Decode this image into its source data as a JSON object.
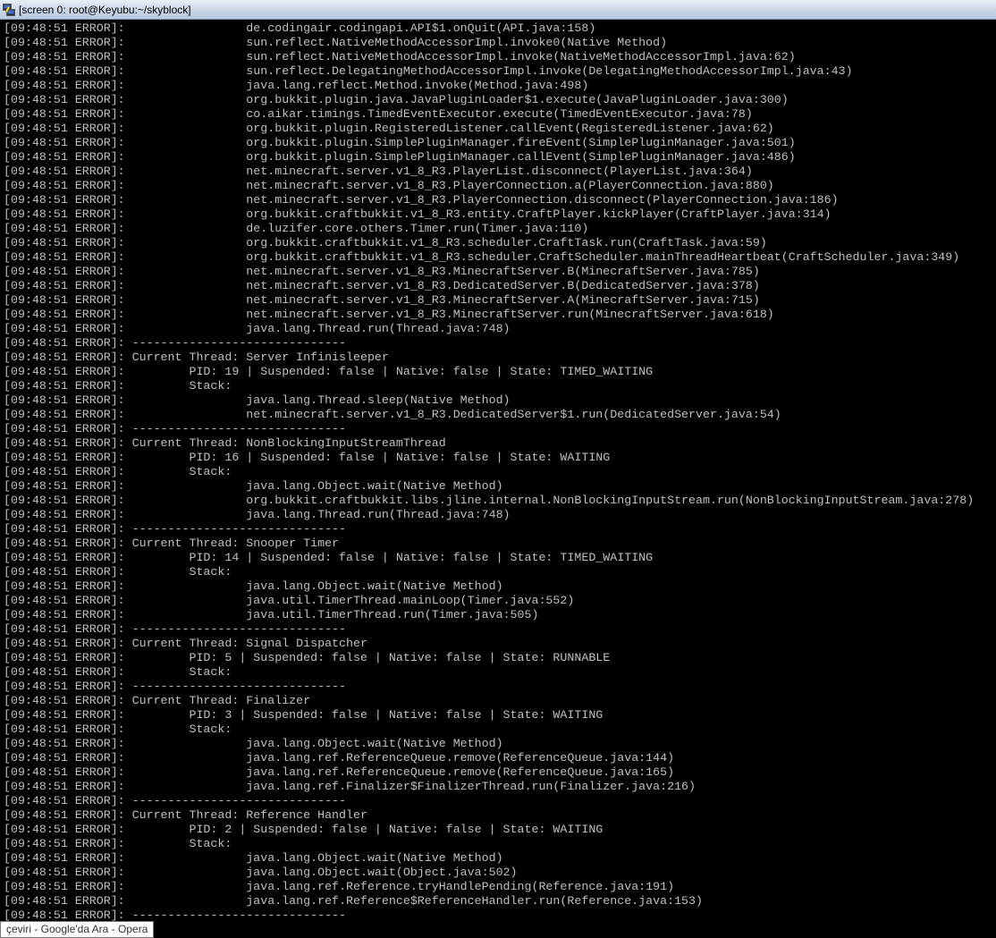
{
  "window": {
    "title": "[screen 0: root@Keyubu:~/skyblock]"
  },
  "terminal": {
    "lines": [
      "[09:48:51 ERROR]:                 de.codingair.codingapi.API$1.onQuit(API.java:158)",
      "[09:48:51 ERROR]:                 sun.reflect.NativeMethodAccessorImpl.invoke0(Native Method)",
      "[09:48:51 ERROR]:                 sun.reflect.NativeMethodAccessorImpl.invoke(NativeMethodAccessorImpl.java:62)",
      "[09:48:51 ERROR]:                 sun.reflect.DelegatingMethodAccessorImpl.invoke(DelegatingMethodAccessorImpl.java:43)",
      "[09:48:51 ERROR]:                 java.lang.reflect.Method.invoke(Method.java:498)",
      "[09:48:51 ERROR]:                 org.bukkit.plugin.java.JavaPluginLoader$1.execute(JavaPluginLoader.java:300)",
      "[09:48:51 ERROR]:                 co.aikar.timings.TimedEventExecutor.execute(TimedEventExecutor.java:78)",
      "[09:48:51 ERROR]:                 org.bukkit.plugin.RegisteredListener.callEvent(RegisteredListener.java:62)",
      "[09:48:51 ERROR]:                 org.bukkit.plugin.SimplePluginManager.fireEvent(SimplePluginManager.java:501)",
      "[09:48:51 ERROR]:                 org.bukkit.plugin.SimplePluginManager.callEvent(SimplePluginManager.java:486)",
      "[09:48:51 ERROR]:                 net.minecraft.server.v1_8_R3.PlayerList.disconnect(PlayerList.java:364)",
      "[09:48:51 ERROR]:                 net.minecraft.server.v1_8_R3.PlayerConnection.a(PlayerConnection.java:880)",
      "[09:48:51 ERROR]:                 net.minecraft.server.v1_8_R3.PlayerConnection.disconnect(PlayerConnection.java:186)",
      "[09:48:51 ERROR]:                 org.bukkit.craftbukkit.v1_8_R3.entity.CraftPlayer.kickPlayer(CraftPlayer.java:314)",
      "[09:48:51 ERROR]:                 de.luzifer.core.others.Timer.run(Timer.java:110)",
      "[09:48:51 ERROR]:                 org.bukkit.craftbukkit.v1_8_R3.scheduler.CraftTask.run(CraftTask.java:59)",
      "[09:48:51 ERROR]:                 org.bukkit.craftbukkit.v1_8_R3.scheduler.CraftScheduler.mainThreadHeartbeat(CraftScheduler.java:349)",
      "[09:48:51 ERROR]:                 net.minecraft.server.v1_8_R3.MinecraftServer.B(MinecraftServer.java:785)",
      "[09:48:51 ERROR]:                 net.minecraft.server.v1_8_R3.DedicatedServer.B(DedicatedServer.java:378)",
      "[09:48:51 ERROR]:                 net.minecraft.server.v1_8_R3.MinecraftServer.A(MinecraftServer.java:715)",
      "[09:48:51 ERROR]:                 net.minecraft.server.v1_8_R3.MinecraftServer.run(MinecraftServer.java:618)",
      "[09:48:51 ERROR]:                 java.lang.Thread.run(Thread.java:748)",
      "[09:48:51 ERROR]: ------------------------------",
      "[09:48:51 ERROR]: Current Thread: Server Infinisleeper",
      "[09:48:51 ERROR]:         PID: 19 | Suspended: false | Native: false | State: TIMED_WAITING",
      "[09:48:51 ERROR]:         Stack:",
      "[09:48:51 ERROR]:                 java.lang.Thread.sleep(Native Method)",
      "[09:48:51 ERROR]:                 net.minecraft.server.v1_8_R3.DedicatedServer$1.run(DedicatedServer.java:54)",
      "[09:48:51 ERROR]: ------------------------------",
      "[09:48:51 ERROR]: Current Thread: NonBlockingInputStreamThread",
      "[09:48:51 ERROR]:         PID: 16 | Suspended: false | Native: false | State: WAITING",
      "[09:48:51 ERROR]:         Stack:",
      "[09:48:51 ERROR]:                 java.lang.Object.wait(Native Method)",
      "[09:48:51 ERROR]:                 org.bukkit.craftbukkit.libs.jline.internal.NonBlockingInputStream.run(NonBlockingInputStream.java:278)",
      "[09:48:51 ERROR]:                 java.lang.Thread.run(Thread.java:748)",
      "[09:48:51 ERROR]: ------------------------------",
      "[09:48:51 ERROR]: Current Thread: Snooper Timer",
      "[09:48:51 ERROR]:         PID: 14 | Suspended: false | Native: false | State: TIMED_WAITING",
      "[09:48:51 ERROR]:         Stack:",
      "[09:48:51 ERROR]:                 java.lang.Object.wait(Native Method)",
      "[09:48:51 ERROR]:                 java.util.TimerThread.mainLoop(Timer.java:552)",
      "[09:48:51 ERROR]:                 java.util.TimerThread.run(Timer.java:505)",
      "[09:48:51 ERROR]: ------------------------------",
      "[09:48:51 ERROR]: Current Thread: Signal Dispatcher",
      "[09:48:51 ERROR]:         PID: 5 | Suspended: false | Native: false | State: RUNNABLE",
      "[09:48:51 ERROR]:         Stack:",
      "[09:48:51 ERROR]: ------------------------------",
      "[09:48:51 ERROR]: Current Thread: Finalizer",
      "[09:48:51 ERROR]:         PID: 3 | Suspended: false | Native: false | State: WAITING",
      "[09:48:51 ERROR]:         Stack:",
      "[09:48:51 ERROR]:                 java.lang.Object.wait(Native Method)",
      "[09:48:51 ERROR]:                 java.lang.ref.ReferenceQueue.remove(ReferenceQueue.java:144)",
      "[09:48:51 ERROR]:                 java.lang.ref.ReferenceQueue.remove(ReferenceQueue.java:165)",
      "[09:48:51 ERROR]:                 java.lang.ref.Finalizer$FinalizerThread.run(Finalizer.java:216)",
      "[09:48:51 ERROR]: ------------------------------",
      "[09:48:51 ERROR]: Current Thread: Reference Handler",
      "[09:48:51 ERROR]:         PID: 2 | Suspended: false | Native: false | State: WAITING",
      "[09:48:51 ERROR]:         Stack:",
      "[09:48:51 ERROR]:                 java.lang.Object.wait(Native Method)",
      "[09:48:51 ERROR]:                 java.lang.Object.wait(Object.java:502)",
      "[09:48:51 ERROR]:                 java.lang.ref.Reference.tryHandlePending(Reference.java:191)",
      "[09:48:51 ERROR]:                 java.lang.ref.Reference$ReferenceHandler.run(Reference.java:153)",
      "[09:48:51 ERROR]: ------------------------------"
    ]
  },
  "tooltip": {
    "text": "çeviri - Google'da Ara - Opera"
  },
  "colors": {
    "terminal_bg": "#000000",
    "terminal_fg": "#c0c0c0"
  },
  "icons": {
    "app": "putty-icon"
  }
}
